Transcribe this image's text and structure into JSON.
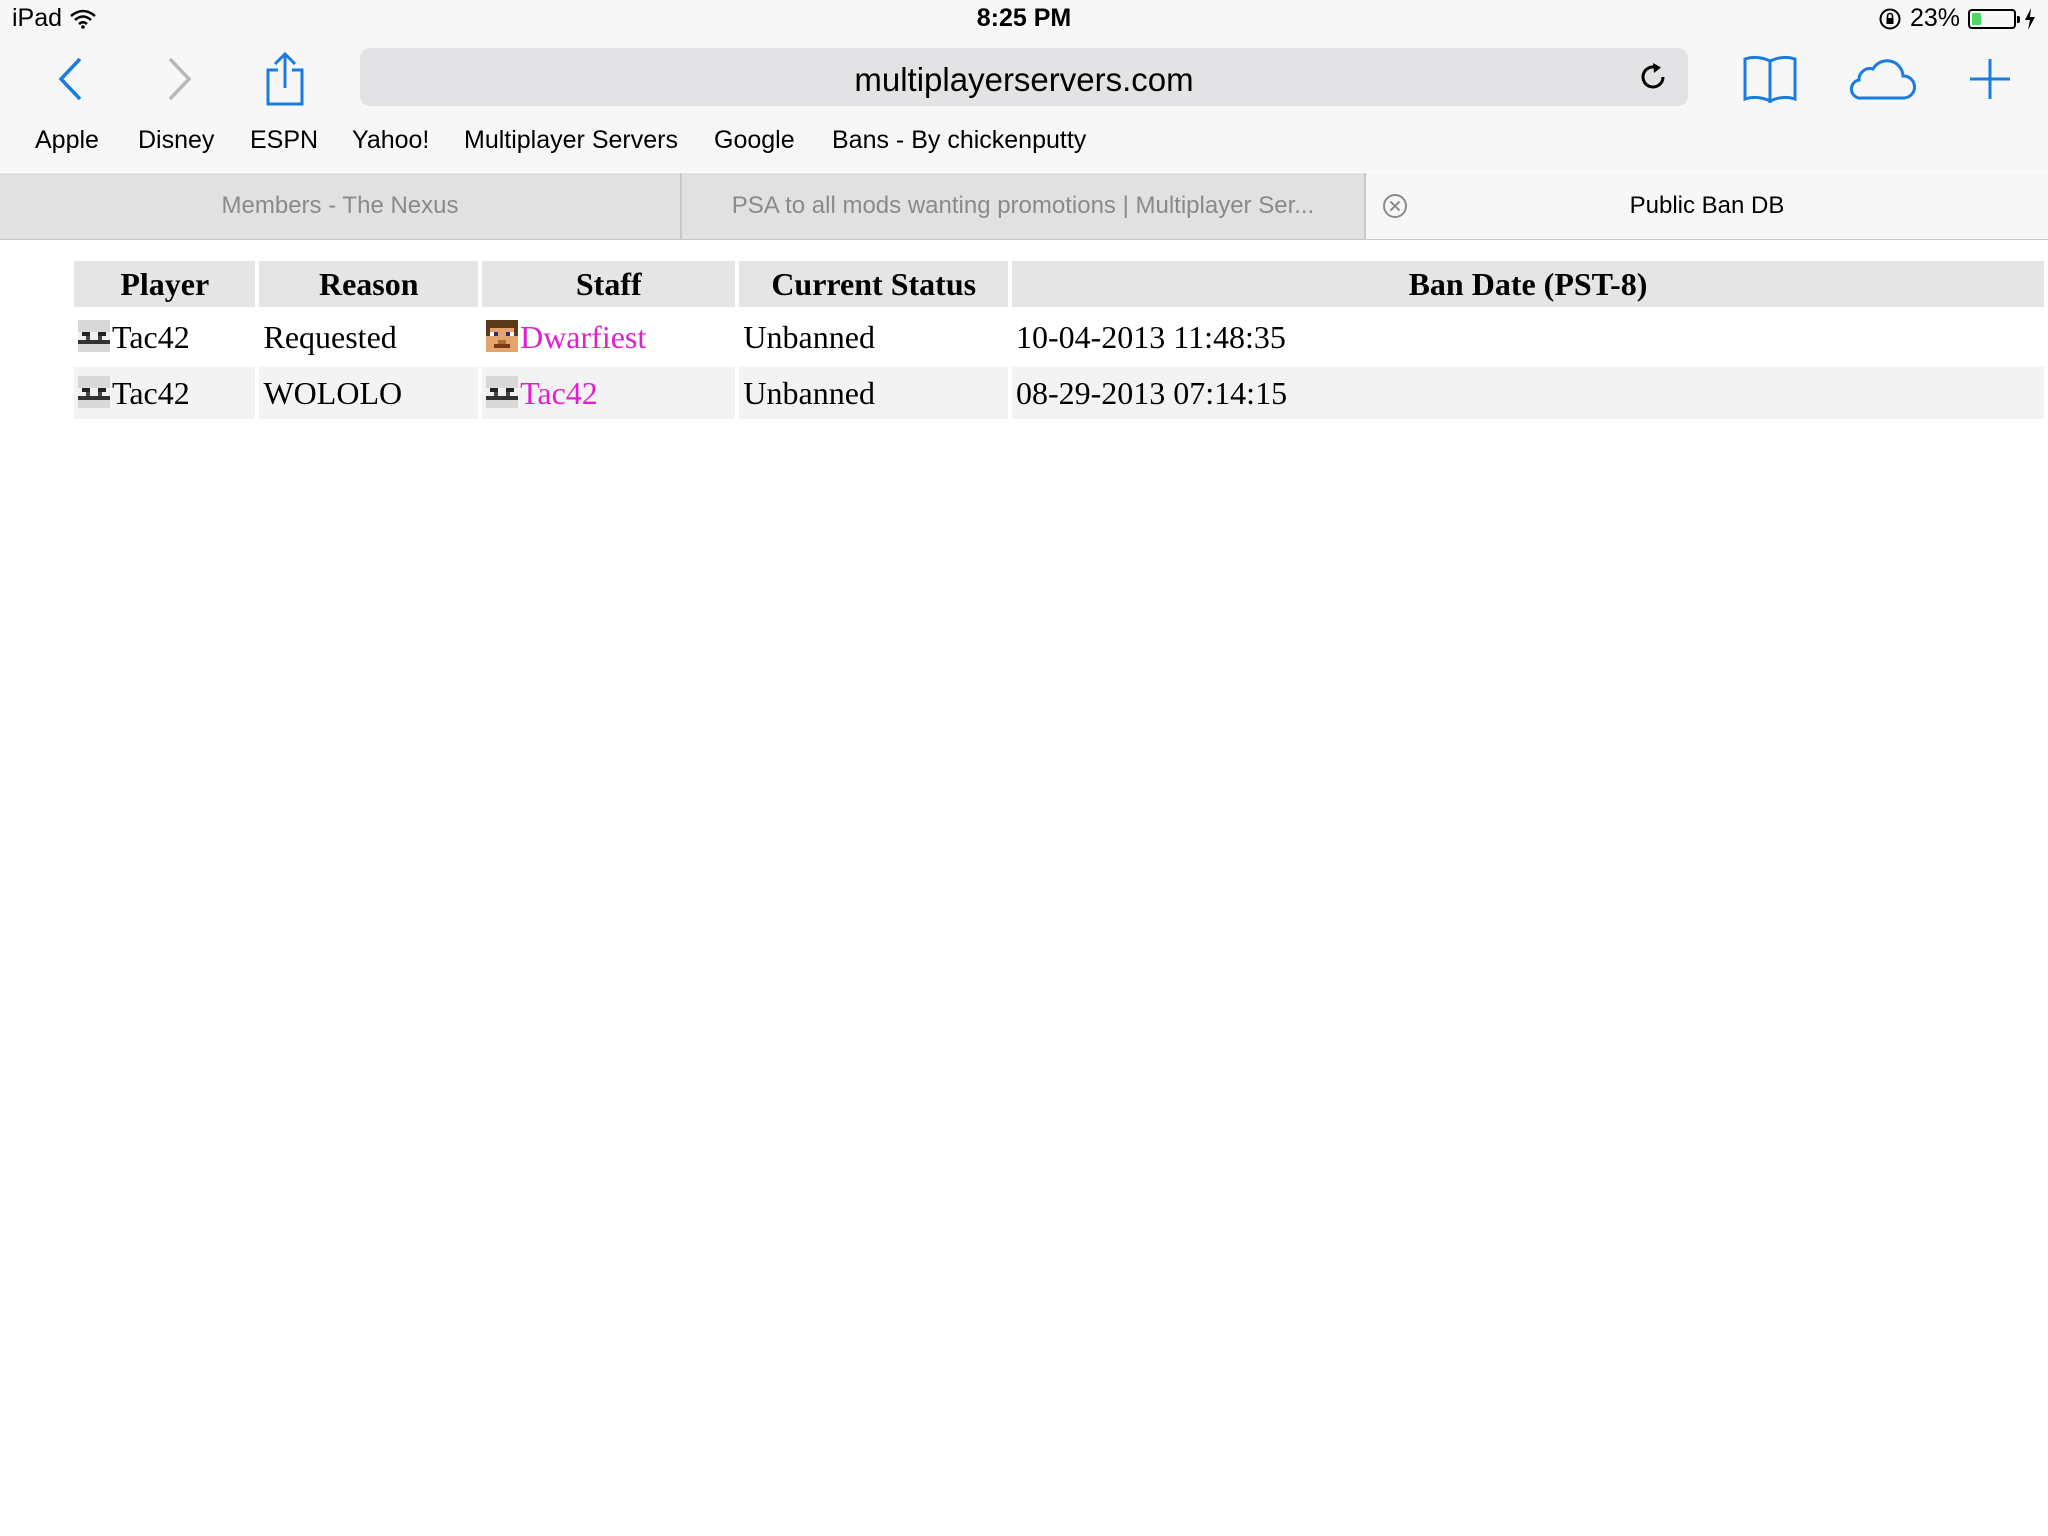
{
  "status_bar": {
    "device": "iPad",
    "time": "8:25 PM",
    "battery_percent": "23%",
    "battery_level": 0.23
  },
  "toolbar": {
    "url": "multiplayerservers.com"
  },
  "bookmarks": [
    "Apple",
    "Disney",
    "ESPN",
    "Yahoo!",
    "Multiplayer Servers",
    "Google",
    "Bans - By chickenputty"
  ],
  "tabs": [
    {
      "label": "Members - The Nexus"
    },
    {
      "label": "PSA to all mods wanting promotions | Multiplayer Ser..."
    },
    {
      "label": "Public Ban DB"
    }
  ],
  "ban_table": {
    "headers": [
      "Player",
      "Reason",
      "Staff",
      "Current Status",
      "Ban Date (PST-8)"
    ],
    "rows": [
      {
        "player": "Tac42",
        "reason": "Requested",
        "staff": "Dwarfiest",
        "status": "Unbanned",
        "date": "10-04-2013 11:48:35"
      },
      {
        "player": "Tac42",
        "reason": "WOLOLO",
        "staff": "Tac42",
        "status": "Unbanned",
        "date": "08-29-2013 07:14:15"
      }
    ]
  },
  "colors": {
    "accent": "#1b7ce0",
    "staff_link": "#e020d0",
    "status_unbanned": "#1a7a1a",
    "battery": "#4cd964"
  },
  "icons": [
    "wifi-icon",
    "back-icon",
    "forward-icon",
    "share-icon",
    "reload-icon",
    "bookmarks-icon",
    "icloud-tabs-icon",
    "new-tab-icon",
    "tab-close-icon",
    "lock-rotation-icon",
    "charging-icon",
    "player-head-icon"
  ]
}
